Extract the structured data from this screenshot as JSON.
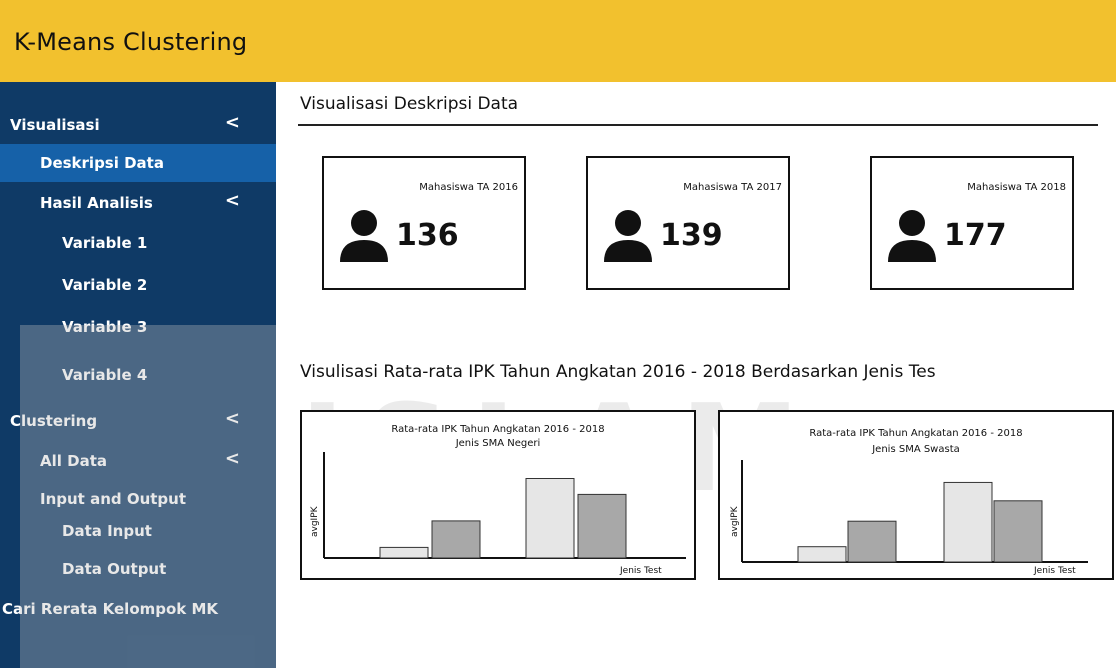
{
  "header": {
    "title": "K-Means Clustering"
  },
  "sidebar": {
    "items": [
      {
        "label": "Visualisasi",
        "chevron": "<",
        "active": false
      },
      {
        "label": "Deskripsi Data",
        "chevron": "",
        "active": true
      },
      {
        "label": "Hasil Analisis",
        "chevron": "<",
        "active": false
      },
      {
        "label": "Variable 1",
        "chevron": "",
        "active": false
      },
      {
        "label": "Variable 2",
        "chevron": "",
        "active": false
      },
      {
        "label": "Variable 3",
        "chevron": "",
        "active": false
      },
      {
        "label": "Variable 4",
        "chevron": "",
        "active": false
      },
      {
        "label": "Clustering",
        "chevron": "<",
        "active": false
      },
      {
        "label": "All Data",
        "chevron": "<",
        "active": false
      },
      {
        "label": "Input and Output",
        "chevron": "",
        "active": false
      },
      {
        "label": "Data Input",
        "chevron": "",
        "active": false
      },
      {
        "label": "Data Output",
        "chevron": "",
        "active": false
      },
      {
        "label": "Cari Rerata Kelompok MK",
        "chevron": "",
        "active": false
      }
    ]
  },
  "main": {
    "section1_title": "Visualisasi Deskripsi Data",
    "cards": [
      {
        "caption": "Mahasiswa TA 2016",
        "value": "136",
        "icon": "user-icon"
      },
      {
        "caption": "Mahasiswa TA 2017",
        "value": "139",
        "icon": "user-icon"
      },
      {
        "caption": "Mahasiswa TA 2018",
        "value": "177",
        "icon": "user-icon"
      }
    ],
    "section2_title": "Visulisasi Rata-rata IPK Tahun Angkatan 2016 - 2018 Berdasarkan Jenis Tes"
  },
  "watermark_text": "ISLAM",
  "chart_data": [
    {
      "type": "bar",
      "title": "Rata-rata IPK Tahun Angkatan 2016 - 2018",
      "subtitle": "Jenis SMA Negeri",
      "xlabel": "Jenis Test",
      "ylabel": "avgIPK",
      "values": [
        0.1,
        0.35,
        0.75,
        0.6
      ],
      "colors": [
        "#e6e6e6",
        "#a8a8a8",
        "#e6e6e6",
        "#a8a8a8"
      ]
    },
    {
      "type": "bar",
      "title": "Rata-rata IPK Tahun Angkatan 2016 - 2018",
      "subtitle": "Jenis SMA Swasta",
      "xlabel": "Jenis Test",
      "ylabel": "avgIPK",
      "values": [
        0.15,
        0.4,
        0.78,
        0.6
      ],
      "colors": [
        "#e6e6e6",
        "#a8a8a8",
        "#e6e6e6",
        "#a8a8a8"
      ]
    }
  ]
}
